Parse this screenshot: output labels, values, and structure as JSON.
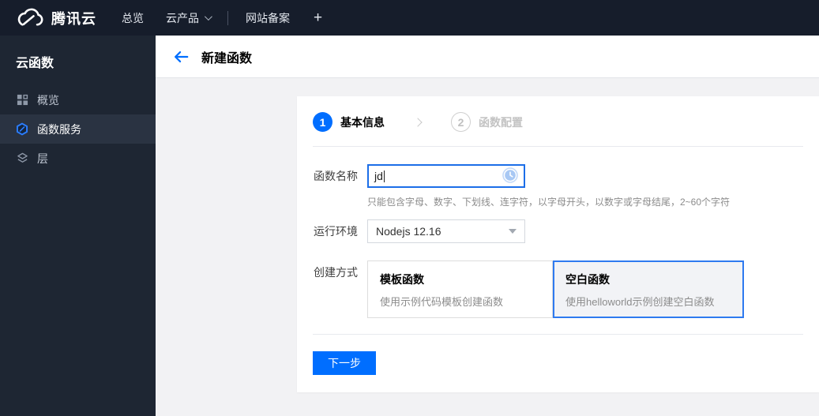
{
  "topbar": {
    "brand": "腾讯云",
    "nav_overview": "总览",
    "nav_cloud_products": "云产品",
    "nav_icp": "网站备案",
    "nav_add": "+"
  },
  "sidebar": {
    "title": "云函数",
    "items": [
      {
        "label": "概览",
        "icon": "overview-grid-icon",
        "selected": false
      },
      {
        "label": "函数服务",
        "icon": "scf-hexagon-icon",
        "selected": true
      },
      {
        "label": "层",
        "icon": "layers-icon",
        "selected": false
      }
    ]
  },
  "header": {
    "title": "新建函数"
  },
  "steps": [
    {
      "num": "1",
      "label": "基本信息",
      "active": true
    },
    {
      "num": "2",
      "label": "函数配置",
      "active": false
    }
  ],
  "form": {
    "name": {
      "label": "函数名称",
      "value": "jd",
      "help": "只能包含字母、数字、下划线、连字符，以字母开头，以数字或字母结尾，2~60个字符"
    },
    "runtime": {
      "label": "运行环境",
      "value": "Nodejs 12.16"
    },
    "create_method": {
      "label": "创建方式",
      "options": [
        {
          "title": "模板函数",
          "desc": "使用示例代码模板创建函数",
          "selected": false
        },
        {
          "title": "空白函数",
          "desc": "使用helloworld示例创建空白函数",
          "selected": true
        }
      ]
    }
  },
  "footer": {
    "next_label": "下一步"
  },
  "colors": {
    "accent": "#006eff",
    "topbar_bg": "#161d2b",
    "sidebar_bg": "#1e2633"
  }
}
